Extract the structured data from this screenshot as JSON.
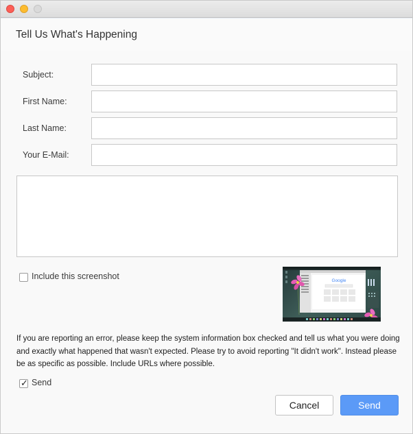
{
  "window": {
    "controls": {
      "close": "close-button",
      "minimize": "minimize-button",
      "zoom": "zoom-button"
    }
  },
  "header": {
    "title": "Tell Us What's Happening"
  },
  "form": {
    "subject_label": "Subject:",
    "subject_value": "",
    "first_name_label": "First Name:",
    "first_name_value": "",
    "last_name_label": "Last Name:",
    "last_name_value": "",
    "email_label": "Your E-Mail:",
    "email_value": "",
    "description_value": ""
  },
  "screenshot_option": {
    "label": "Include this screenshot",
    "checked": false,
    "thumbnail_logo": "Google"
  },
  "info_text": "If you are reporting an error, please keep the system information box checked and tell us what you were doing and exactly what happened that wasn't expected. Please try to avoid reporting \"It didn't work\". Instead please be as specific as possible. Include URLs where possible.",
  "send_option": {
    "label": "Send",
    "checked": true
  },
  "buttons": {
    "cancel": "Cancel",
    "send": "Send"
  },
  "colors": {
    "primary_button": "#5b9af7",
    "close_light": "#fc5f57",
    "minimize_light": "#fdbc2f"
  }
}
